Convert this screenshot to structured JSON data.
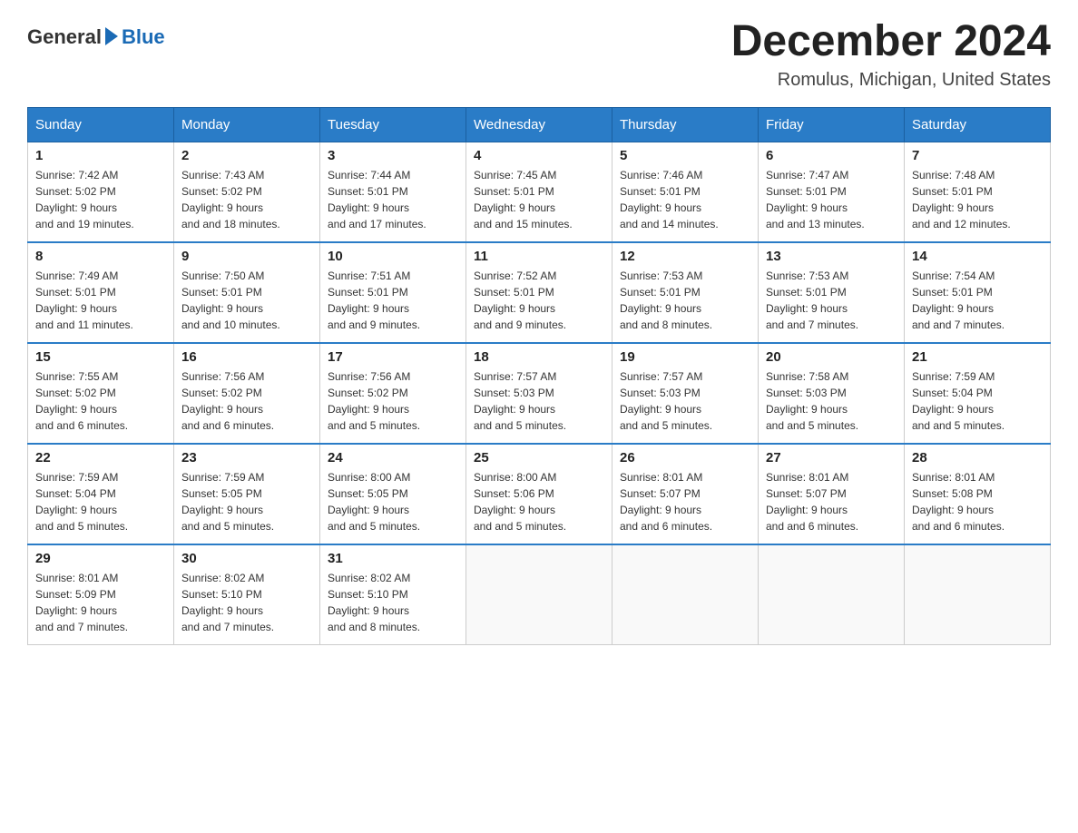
{
  "header": {
    "logo_text_general": "General",
    "logo_text_blue": "Blue",
    "month_title": "December 2024",
    "location": "Romulus, Michigan, United States"
  },
  "weekdays": [
    "Sunday",
    "Monday",
    "Tuesday",
    "Wednesday",
    "Thursday",
    "Friday",
    "Saturday"
  ],
  "weeks": [
    [
      {
        "day": "1",
        "sunrise": "7:42 AM",
        "sunset": "5:02 PM",
        "daylight": "9 hours and 19 minutes."
      },
      {
        "day": "2",
        "sunrise": "7:43 AM",
        "sunset": "5:02 PM",
        "daylight": "9 hours and 18 minutes."
      },
      {
        "day": "3",
        "sunrise": "7:44 AM",
        "sunset": "5:01 PM",
        "daylight": "9 hours and 17 minutes."
      },
      {
        "day": "4",
        "sunrise": "7:45 AM",
        "sunset": "5:01 PM",
        "daylight": "9 hours and 15 minutes."
      },
      {
        "day": "5",
        "sunrise": "7:46 AM",
        "sunset": "5:01 PM",
        "daylight": "9 hours and 14 minutes."
      },
      {
        "day": "6",
        "sunrise": "7:47 AM",
        "sunset": "5:01 PM",
        "daylight": "9 hours and 13 minutes."
      },
      {
        "day": "7",
        "sunrise": "7:48 AM",
        "sunset": "5:01 PM",
        "daylight": "9 hours and 12 minutes."
      }
    ],
    [
      {
        "day": "8",
        "sunrise": "7:49 AM",
        "sunset": "5:01 PM",
        "daylight": "9 hours and 11 minutes."
      },
      {
        "day": "9",
        "sunrise": "7:50 AM",
        "sunset": "5:01 PM",
        "daylight": "9 hours and 10 minutes."
      },
      {
        "day": "10",
        "sunrise": "7:51 AM",
        "sunset": "5:01 PM",
        "daylight": "9 hours and 9 minutes."
      },
      {
        "day": "11",
        "sunrise": "7:52 AM",
        "sunset": "5:01 PM",
        "daylight": "9 hours and 9 minutes."
      },
      {
        "day": "12",
        "sunrise": "7:53 AM",
        "sunset": "5:01 PM",
        "daylight": "9 hours and 8 minutes."
      },
      {
        "day": "13",
        "sunrise": "7:53 AM",
        "sunset": "5:01 PM",
        "daylight": "9 hours and 7 minutes."
      },
      {
        "day": "14",
        "sunrise": "7:54 AM",
        "sunset": "5:01 PM",
        "daylight": "9 hours and 7 minutes."
      }
    ],
    [
      {
        "day": "15",
        "sunrise": "7:55 AM",
        "sunset": "5:02 PM",
        "daylight": "9 hours and 6 minutes."
      },
      {
        "day": "16",
        "sunrise": "7:56 AM",
        "sunset": "5:02 PM",
        "daylight": "9 hours and 6 minutes."
      },
      {
        "day": "17",
        "sunrise": "7:56 AM",
        "sunset": "5:02 PM",
        "daylight": "9 hours and 5 minutes."
      },
      {
        "day": "18",
        "sunrise": "7:57 AM",
        "sunset": "5:03 PM",
        "daylight": "9 hours and 5 minutes."
      },
      {
        "day": "19",
        "sunrise": "7:57 AM",
        "sunset": "5:03 PM",
        "daylight": "9 hours and 5 minutes."
      },
      {
        "day": "20",
        "sunrise": "7:58 AM",
        "sunset": "5:03 PM",
        "daylight": "9 hours and 5 minutes."
      },
      {
        "day": "21",
        "sunrise": "7:59 AM",
        "sunset": "5:04 PM",
        "daylight": "9 hours and 5 minutes."
      }
    ],
    [
      {
        "day": "22",
        "sunrise": "7:59 AM",
        "sunset": "5:04 PM",
        "daylight": "9 hours and 5 minutes."
      },
      {
        "day": "23",
        "sunrise": "7:59 AM",
        "sunset": "5:05 PM",
        "daylight": "9 hours and 5 minutes."
      },
      {
        "day": "24",
        "sunrise": "8:00 AM",
        "sunset": "5:05 PM",
        "daylight": "9 hours and 5 minutes."
      },
      {
        "day": "25",
        "sunrise": "8:00 AM",
        "sunset": "5:06 PM",
        "daylight": "9 hours and 5 minutes."
      },
      {
        "day": "26",
        "sunrise": "8:01 AM",
        "sunset": "5:07 PM",
        "daylight": "9 hours and 6 minutes."
      },
      {
        "day": "27",
        "sunrise": "8:01 AM",
        "sunset": "5:07 PM",
        "daylight": "9 hours and 6 minutes."
      },
      {
        "day": "28",
        "sunrise": "8:01 AM",
        "sunset": "5:08 PM",
        "daylight": "9 hours and 6 minutes."
      }
    ],
    [
      {
        "day": "29",
        "sunrise": "8:01 AM",
        "sunset": "5:09 PM",
        "daylight": "9 hours and 7 minutes."
      },
      {
        "day": "30",
        "sunrise": "8:02 AM",
        "sunset": "5:10 PM",
        "daylight": "9 hours and 7 minutes."
      },
      {
        "day": "31",
        "sunrise": "8:02 AM",
        "sunset": "5:10 PM",
        "daylight": "9 hours and 8 minutes."
      },
      null,
      null,
      null,
      null
    ]
  ],
  "labels": {
    "sunrise": "Sunrise:",
    "sunset": "Sunset:",
    "daylight": "Daylight:"
  }
}
